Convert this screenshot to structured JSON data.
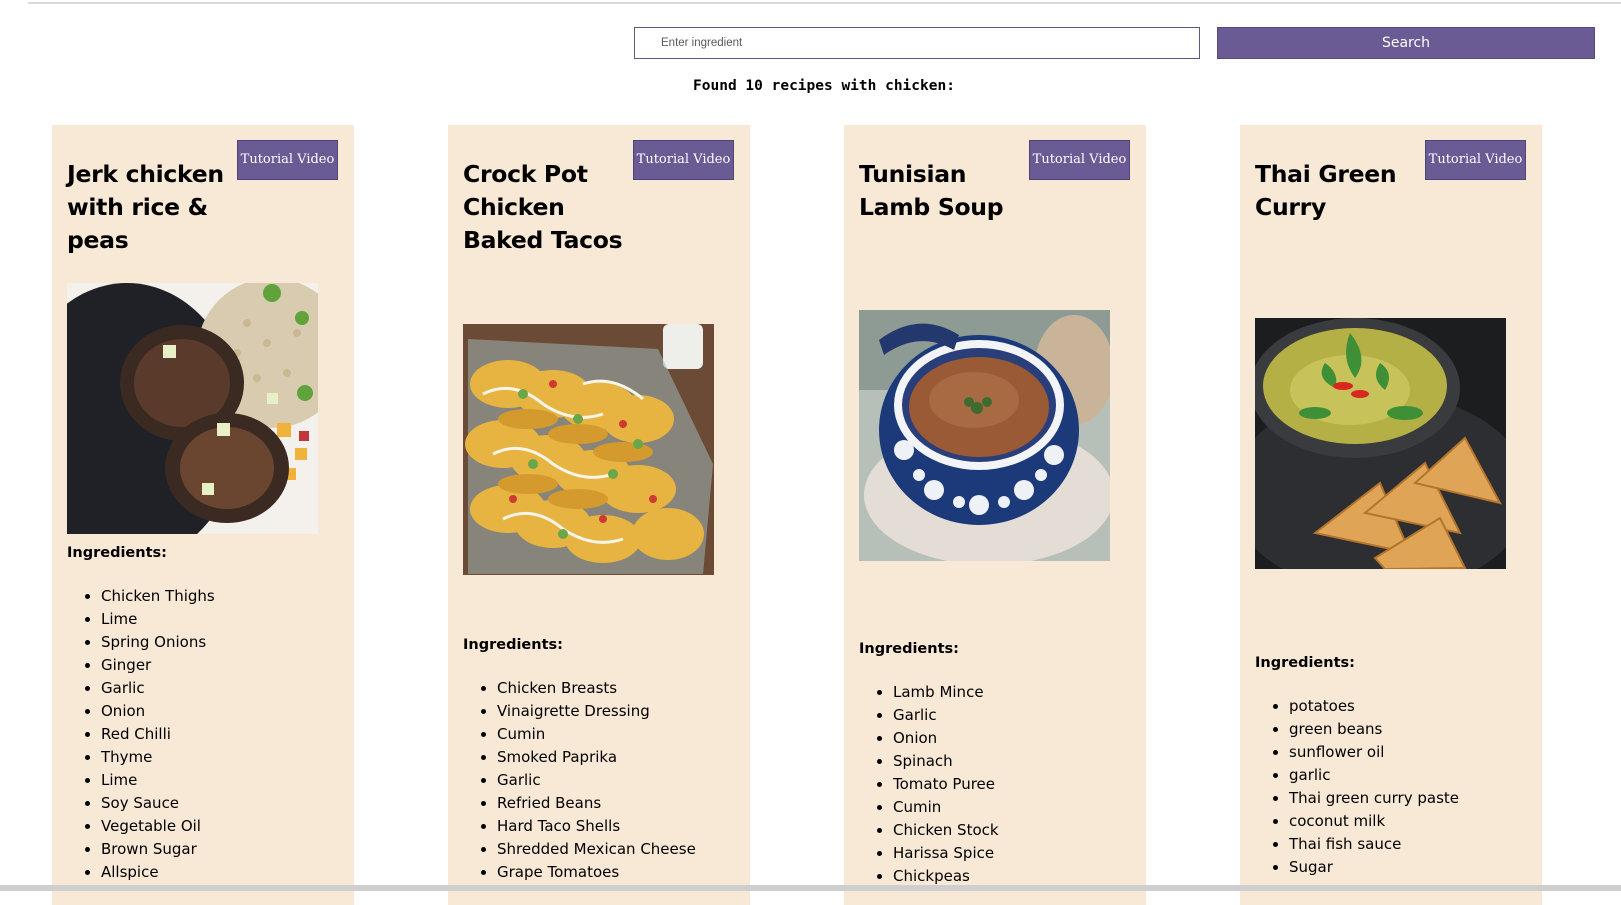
{
  "search": {
    "placeholder": "Enter ingredient",
    "button_label": "Search"
  },
  "results_heading": "Found 10 recipes with chicken:",
  "recipes": [
    {
      "title": "Jerk chicken with rice & peas",
      "video_label": "Tutorial Video",
      "ingredients_heading": "Ingredients:",
      "image_subject": "jerk chicken with rice and peas",
      "ingredients": [
        "Chicken Thighs",
        "Lime",
        "Spring Onions",
        "Ginger",
        "Garlic",
        "Onion",
        "Red Chilli",
        "Thyme",
        "Lime",
        "Soy Sauce",
        "Vegetable Oil",
        "Brown Sugar",
        "Allspice"
      ]
    },
    {
      "title": "Crock Pot Chicken Baked Tacos",
      "video_label": "Tutorial Video",
      "ingredients_heading": "Ingredients:",
      "image_subject": "baked tacos in a glass dish",
      "ingredients": [
        "Chicken Breasts",
        "Vinaigrette Dressing",
        "Cumin",
        "Smoked Paprika",
        "Garlic",
        "Refried Beans",
        "Hard Taco Shells",
        "Shredded Mexican Cheese",
        "Grape Tomatoes"
      ]
    },
    {
      "title": "Tunisian Lamb Soup",
      "video_label": "Tutorial Video",
      "ingredients_heading": "Ingredients:",
      "image_subject": "lamb soup in a blue patterned tureen",
      "ingredients": [
        "Lamb Mince",
        "Garlic",
        "Onion",
        "Spinach",
        "Tomato Puree",
        "Cumin",
        "Chicken Stock",
        "Harissa Spice",
        "Chickpeas"
      ]
    },
    {
      "title": "Thai Green Curry",
      "video_label": "Tutorial Video",
      "ingredients_heading": "Ingredients:",
      "image_subject": "green curry with flatbread",
      "ingredients": [
        "potatoes",
        "green beans",
        "sunflower oil",
        "garlic",
        "Thai green curry paste",
        "coconut milk",
        "Thai fish sauce",
        "Sugar"
      ]
    }
  ],
  "colors": {
    "accent": "#6b5b95",
    "card_bg": "#f8e8d6"
  }
}
